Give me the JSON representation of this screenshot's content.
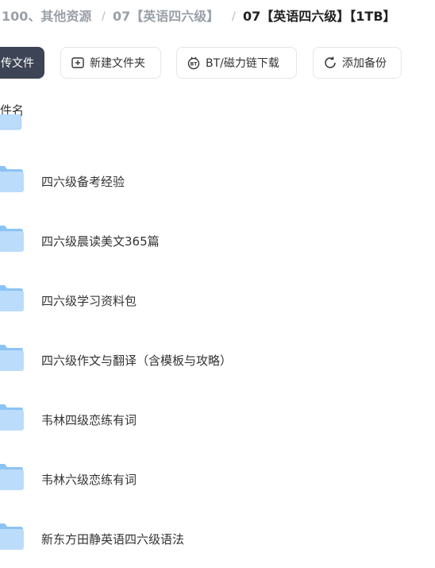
{
  "breadcrumb": {
    "items": [
      "100、其他资源",
      "07【英语四六级】",
      "07【英语四六级】【1TB】"
    ],
    "separator": "/"
  },
  "toolbar": {
    "upload_label": "传文件",
    "new_folder_label": "新建文件夹",
    "bt_label": "BT/磁力链下载",
    "backup_label": "添加备份"
  },
  "table": {
    "column_header": "件名"
  },
  "files": [
    {
      "name": "四六级备考经验"
    },
    {
      "name": "四六级晨读美文365篇"
    },
    {
      "name": "四六级学习资料包"
    },
    {
      "name": "四六级作文与翻译（含模板与攻略）"
    },
    {
      "name": "韦林四级恋练有词"
    },
    {
      "name": "韦林六级恋练有词"
    },
    {
      "name": "新东方田静英语四六级语法"
    }
  ],
  "colors": {
    "primary_button": "#3d4455",
    "folder_light": "#bcdcfb",
    "folder_dark": "#8cc3f5"
  }
}
